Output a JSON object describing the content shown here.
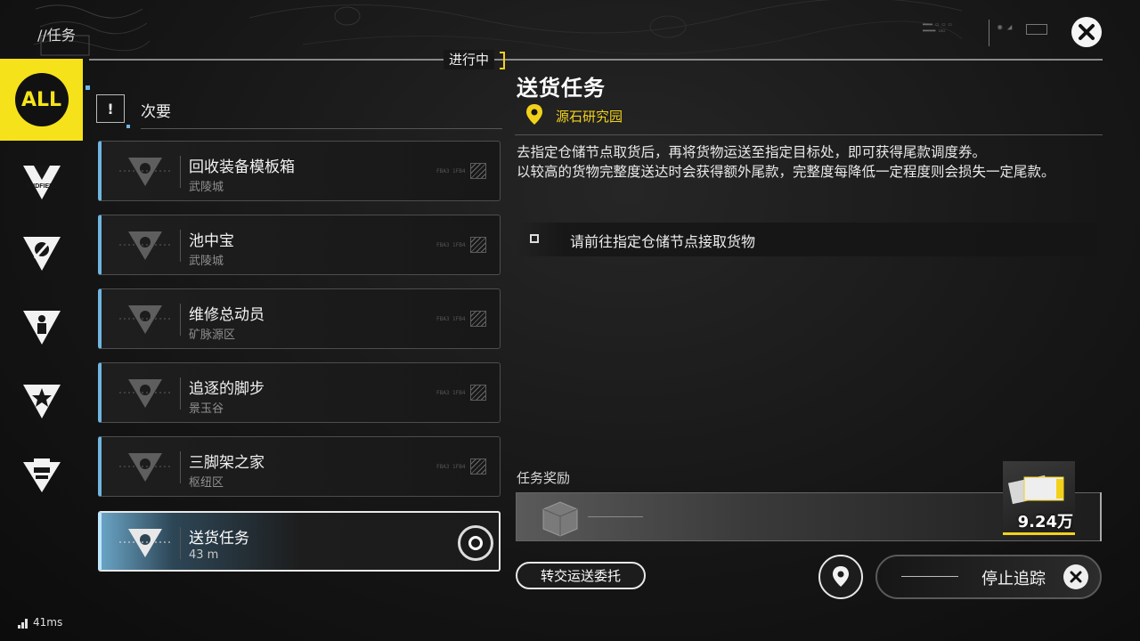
{
  "header": {
    "breadcrumb": "//任务",
    "status_tag": "进行中",
    "close_icon": "close-icon"
  },
  "colors": {
    "accent_yellow": "#f3d11b",
    "tracked_blue": "#6fb6e0",
    "background": "#161616"
  },
  "sidebar": {
    "items": [
      {
        "label": "ALL",
        "icon": "all-filter-icon",
        "selected": true
      },
      {
        "label": "ENDFIELD",
        "icon": "endfield-category-icon"
      },
      {
        "icon": "slash-category-icon"
      },
      {
        "icon": "person-category-icon"
      },
      {
        "icon": "star-category-icon"
      },
      {
        "icon": "box-category-icon"
      }
    ]
  },
  "quest_list": {
    "section_icon": "!",
    "section_label": "次要",
    "cards": [
      {
        "title": "回收装备模板箱",
        "subtitle": "武陵城",
        "code": "FBA3 1FB4"
      },
      {
        "title": "池中宝",
        "subtitle": "武陵城",
        "code": "FBA3 1FB4"
      },
      {
        "title": "维修总动员",
        "subtitle": "矿脉源区",
        "code": "FBA3 1FB4"
      },
      {
        "title": "追逐的脚步",
        "subtitle": "景玉谷",
        "code": "FBA3 1FB4"
      },
      {
        "title": "三脚架之家",
        "subtitle": "枢纽区",
        "code": "FBA3 1FB4"
      },
      {
        "title": "送货任务",
        "subtitle": "43 m",
        "tracked": true
      }
    ]
  },
  "detail": {
    "title": "送货任务",
    "location": "源石研究园",
    "description_1": "去指定仓储节点取货后，再将货物运送至指定目标处，即可获得尾款调度券。",
    "description_2": "以较高的货物完整度送达时会获得额外尾款，完整度每降低一定程度则会损失一定尾款。",
    "objective": "请前往指定仓储节点接取货物",
    "reward_label": "任务奖励",
    "reward_amount": "9.24万",
    "transfer_button": "转交运送委托",
    "stop_tracking_button": "停止追踪"
  },
  "status_bar": {
    "ping": "41ms"
  }
}
